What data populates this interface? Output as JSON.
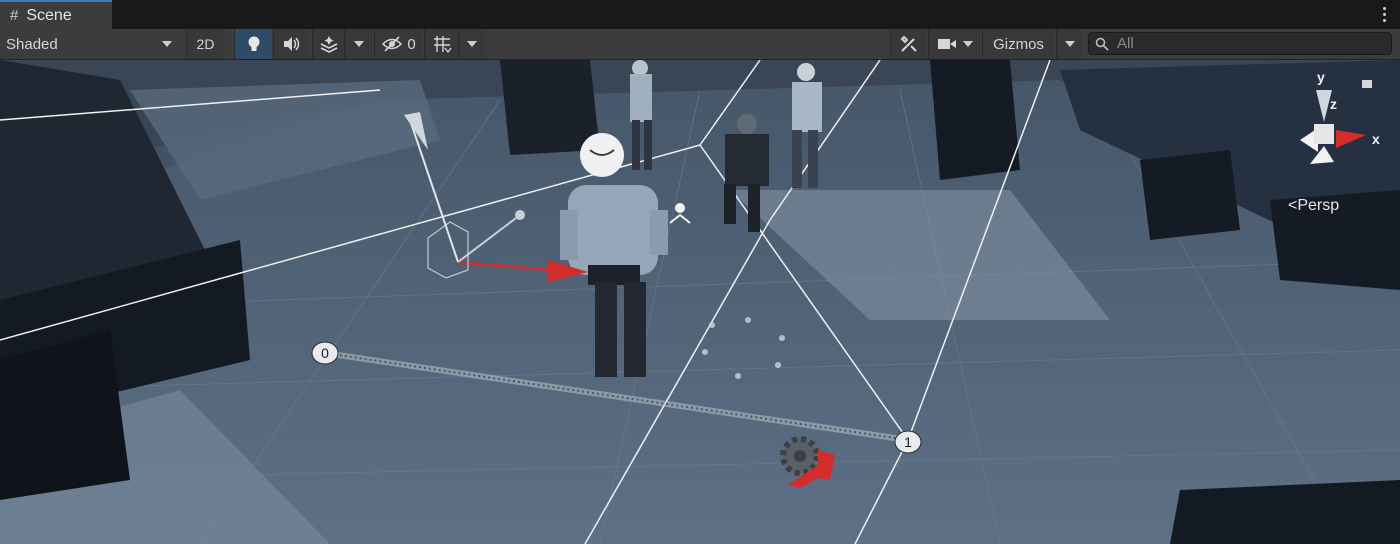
{
  "tab": {
    "icon": "hash-icon",
    "label": "Scene"
  },
  "toolbar": {
    "draw_mode": "Shaded",
    "toggle_2d": "2D",
    "hidden_count": "0",
    "gizmos_label": "Gizmos",
    "search_placeholder": "All"
  },
  "viewport": {
    "projection_label": "Persp",
    "axis_x": "x",
    "axis_y": "y",
    "axis_z": "z",
    "path_point_start": "0",
    "path_point_end": "1"
  },
  "colors": {
    "toolbar_bg": "#3c3c3c",
    "active_toggle": "#2f4a66",
    "tab_accent": "#3a79bb",
    "x_axis": "#d42b2b",
    "floor": "#52637a"
  }
}
